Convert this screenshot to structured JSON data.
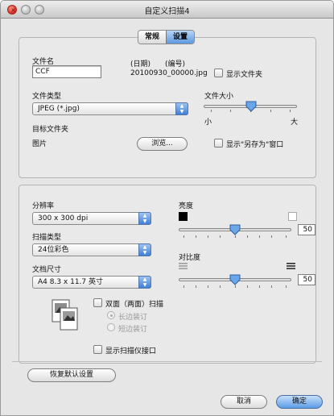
{
  "window": {
    "title": "自定义扫描4"
  },
  "tabs": [
    {
      "label": "常规"
    },
    {
      "label": "设置"
    }
  ],
  "file": {
    "name_label": "文件名",
    "name_value": "CCF",
    "date_label": "(日期)",
    "number_label": "(编号)",
    "example_name": "20100930_00000.jpg",
    "show_folder_label": "显示文件夹",
    "type_label": "文件类型",
    "type_value": "JPEG (*.jpg)",
    "size_label": "文件大小",
    "size_small": "小",
    "size_large": "大",
    "size_level": 0.5,
    "dest_label": "目标文件夹",
    "dest_value": "图片",
    "browse_label": "浏览...",
    "show_save_as_label": "显示\"另存为\"窗口"
  },
  "scan": {
    "resolution_label": "分辨率",
    "resolution_value": "300 x 300 dpi",
    "scan_type_label": "扫描类型",
    "scan_type_value": "24位彩色",
    "doc_size_label": "文档尺寸",
    "doc_size_value": "A4 8.3 x 11.7 英寸",
    "brightness_label": "亮度",
    "brightness_value": "50",
    "contrast_label": "对比度",
    "contrast_value": "50",
    "duplex_label": "双面（两面）扫描",
    "long_edge_label": "长边装订",
    "short_edge_label": "短边装订",
    "show_interface_label": "显示扫描仪接口"
  },
  "footer": {
    "restore_label": "恢复默认设置",
    "cancel_label": "取消",
    "ok_label": "确定"
  },
  "colors": {
    "accent": "#5b9be6",
    "close": "#d8261a"
  }
}
